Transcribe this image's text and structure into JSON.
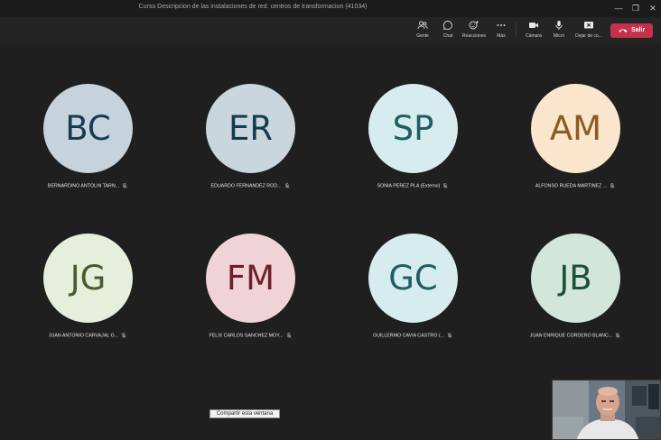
{
  "window": {
    "title": "Curso Descripcion de las instalaciones de red: centros de transformacion (41034)"
  },
  "toolbar": {
    "people": "Gente",
    "chat": "Chat",
    "reactions": "Reacciones",
    "more": "Más",
    "camera": "Cámara",
    "mic": "Micro",
    "stop_share": "Dejar de co...",
    "leave": "Salir"
  },
  "participants": [
    {
      "initials": "BC",
      "name": "BERNARDINO ANTOLIN TARN...",
      "bg": "#c7d3dc",
      "fg": "#173b4e"
    },
    {
      "initials": "ER",
      "name": "EDUARDO FERNANDEZ ROD...",
      "bg": "#c9d6de",
      "fg": "#173b4e"
    },
    {
      "initials": "SP",
      "name": "SONIA PEREZ PLA (Externo)",
      "bg": "#d7ecef",
      "fg": "#1f5f63"
    },
    {
      "initials": "AM",
      "name": "ALFONSO RUEDA MARTINEZ ...",
      "bg": "#f9e6cc",
      "fg": "#8b5b21"
    },
    {
      "initials": "JG",
      "name": "JUAN ANTONIO CARVAJAL G...",
      "bg": "#e6eedc",
      "fg": "#4a5b2e"
    },
    {
      "initials": "FM",
      "name": "FELIX CARLOS SANCHEZ MOY...",
      "bg": "#efd3d6",
      "fg": "#6e1f2b"
    },
    {
      "initials": "GC",
      "name": "GUILLERMO CAVIA CASTRO (...",
      "bg": "#d7ecef",
      "fg": "#1f5f63"
    },
    {
      "initials": "JB",
      "name": "JUAN ENRIQUE CORDERO BLANC...",
      "bg": "#d2e6dc",
      "fg": "#1d5135"
    }
  ],
  "share_button": "Compartir esta ventana",
  "colors": {
    "background": "#1f1f1f",
    "toolbar": "#242424",
    "leave": "#c4314b"
  }
}
